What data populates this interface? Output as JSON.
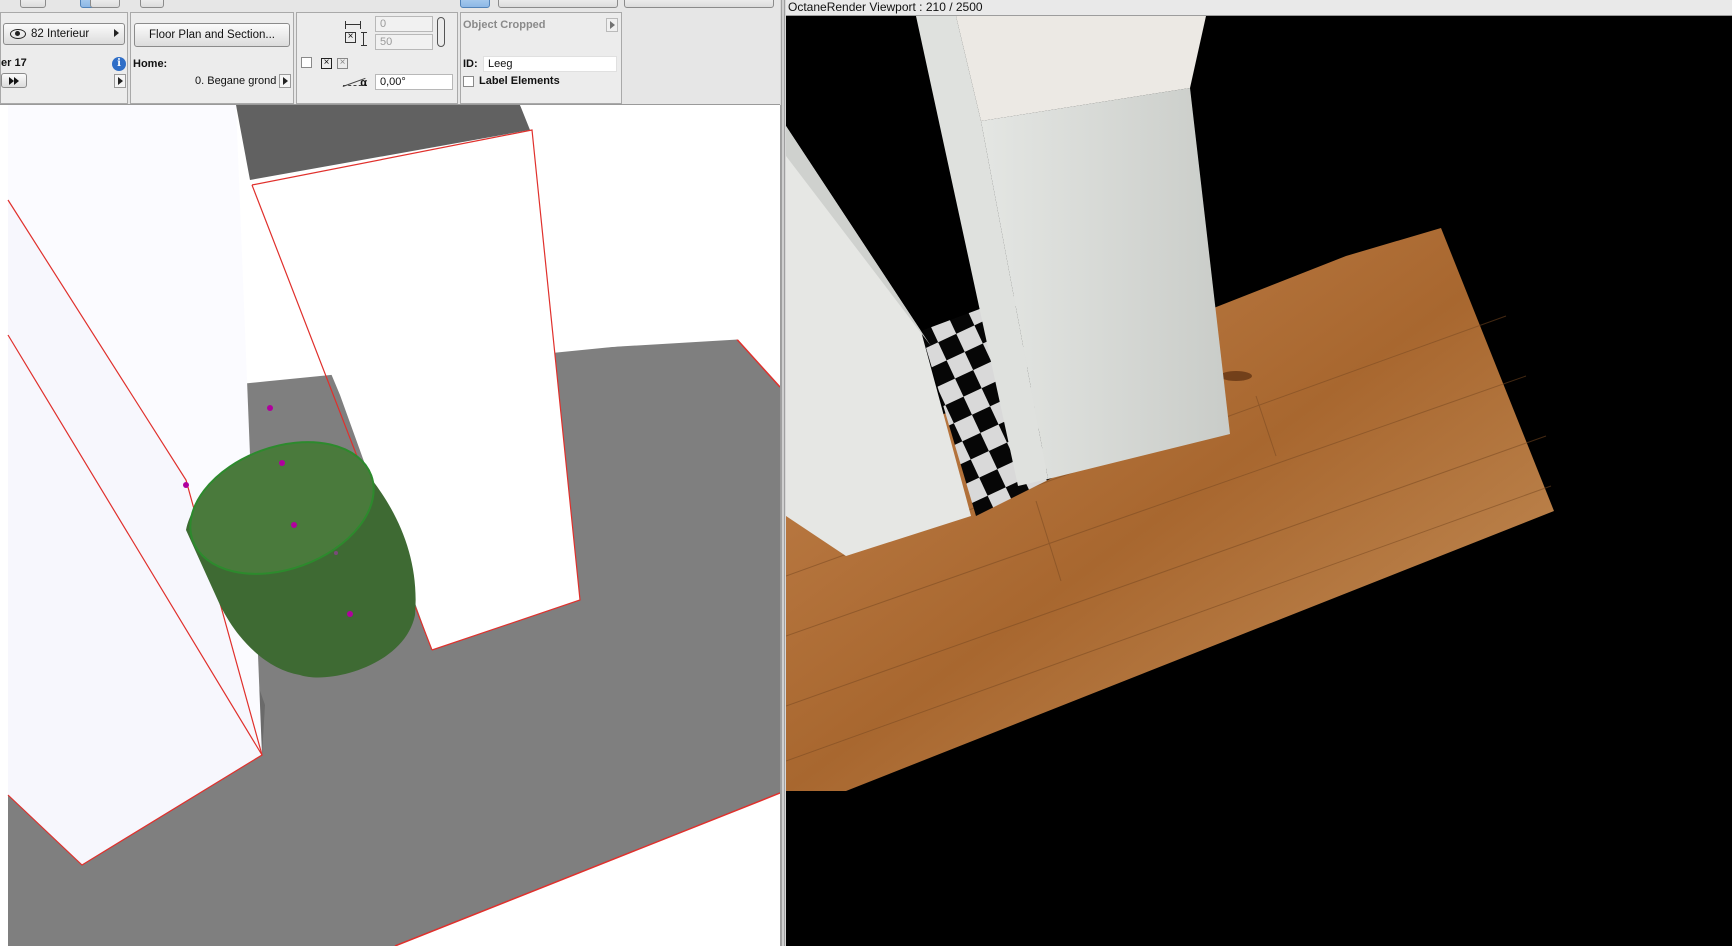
{
  "toolbar": {
    "layer_view_label": "82 Interieur",
    "floor_plan_button": "Floor Plan and Section...",
    "layer_label": "er 17",
    "home_label": "Home:",
    "home_story": "0. Begane grond",
    "width_value": "0",
    "height_value": "50",
    "top_value": "0",
    "angle_value": "0,00°",
    "object_status": "Object Cropped",
    "id_label": "ID:",
    "id_value": "Leeg",
    "label_elements": "Label Elements"
  },
  "octane": {
    "title": "OctaneRender Viewport : 210  / 2500"
  },
  "icons": [
    "eye-icon",
    "info-icon",
    "play-forward-icon",
    "chain-link-icon",
    "angle-icon",
    "width-arrow-icon",
    "height-arrow-icon"
  ],
  "colors": {
    "selection_red": "#e0302c",
    "cylinder_green": "#3f6b33",
    "handle_magenta": "#b0009e",
    "floor_gray": "#808080",
    "wood": "#b97a45",
    "render_bg": "#000000"
  }
}
